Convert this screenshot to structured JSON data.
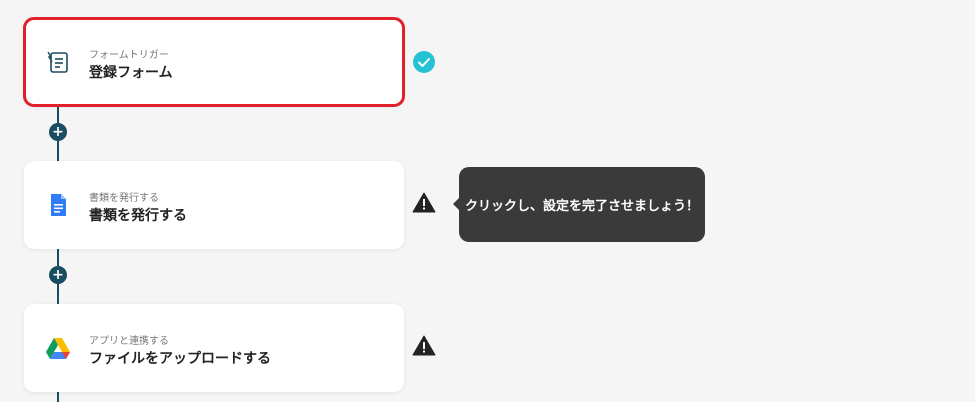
{
  "steps": [
    {
      "subtitle": "フォームトリガー",
      "title": "登録フォーム",
      "icon": "form-icon",
      "status": "complete",
      "selected": true
    },
    {
      "subtitle": "書類を発行する",
      "title": "書類を発行する",
      "icon": "google-docs-icon",
      "status": "warning",
      "selected": false
    },
    {
      "subtitle": "アプリと連携する",
      "title": "ファイルをアップロードする",
      "icon": "google-drive-icon",
      "status": "warning",
      "selected": false
    }
  ],
  "add_step_label": "+",
  "tooltip": {
    "text": "クリックし、設定を完了させましょう！"
  },
  "colors": {
    "line": "#1a4d61",
    "selected_border": "#e0202a",
    "complete": "#25c2d6",
    "warning": "#222222",
    "tooltip_bg": "#3a3a3a"
  }
}
